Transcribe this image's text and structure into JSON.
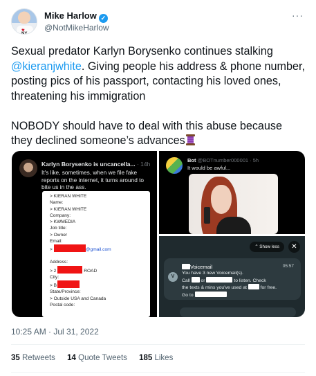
{
  "header": {
    "display_name": "Mike Harlow",
    "handle": "@NotMikeHarlow",
    "verified_icon": "verified-badge-icon",
    "more_icon": "more-options-icon",
    "avatar_text": {
      "heart": "♥",
      "ny": "NY"
    }
  },
  "tweet": {
    "text_part1": "Sexual predator Karlyn Borysenko continues stalking",
    "mention": "@kieranjwhite",
    "text_part2": ". Giving people his address & phone number, posting pics of his passport, contacting his loved ones, threatening his immigration",
    "text_para2": "NOBODY should have to deal with this abuse because they declined someone’s advances",
    "emoji": "spool-of-thread-icon"
  },
  "media": {
    "left": {
      "name": "Karlyn Borysenko is uncancella...",
      "time": "· 14h",
      "text": "It's like, sometimes, when we file fake reports on the internet, it turns around to bite us in the ass.",
      "form_lines": [
        "> KIERAN WHITE",
        "Name:",
        "> KIERAN WHITE",
        "Company:",
        "> KWMEDIA",
        "Job title:",
        "> Owner",
        "Email:",
        ">",
        "@gmail.com",
        "Address:",
        "> 2",
        "ROAD",
        "City:",
        "> B",
        "State/Province:",
        "> Outside USA and Canada",
        "Postal code:"
      ]
    },
    "top_right": {
      "name": "Bot",
      "handle": "@BOTnumber000001 · 5h",
      "text": "It would be awful..."
    },
    "bottom_right": {
      "show_less": "⌃ Show less",
      "close": "✕",
      "avatar_letter": "V",
      "title": "Voicemail",
      "time": "05:57",
      "line1": "You have 3 new Voicemail(s).",
      "line2_a": "Call",
      "line2_b": "or",
      "line2_c": "to listen. Check",
      "line3_a": "the texts & mins you've used at",
      "line3_b": "for free.",
      "line4": "Go to"
    }
  },
  "meta": {
    "timestamp": "10:25 AM · Jul 31, 2022"
  },
  "stats": {
    "retweets_count": "35",
    "retweets_label": "Retweets",
    "quotes_count": "14",
    "quotes_label": "Quote Tweets",
    "likes_count": "185",
    "likes_label": "Likes"
  },
  "colors": {
    "link": "#1d9bf0",
    "text": "#0f1419",
    "muted": "#536471",
    "redaction": "#f01414"
  }
}
